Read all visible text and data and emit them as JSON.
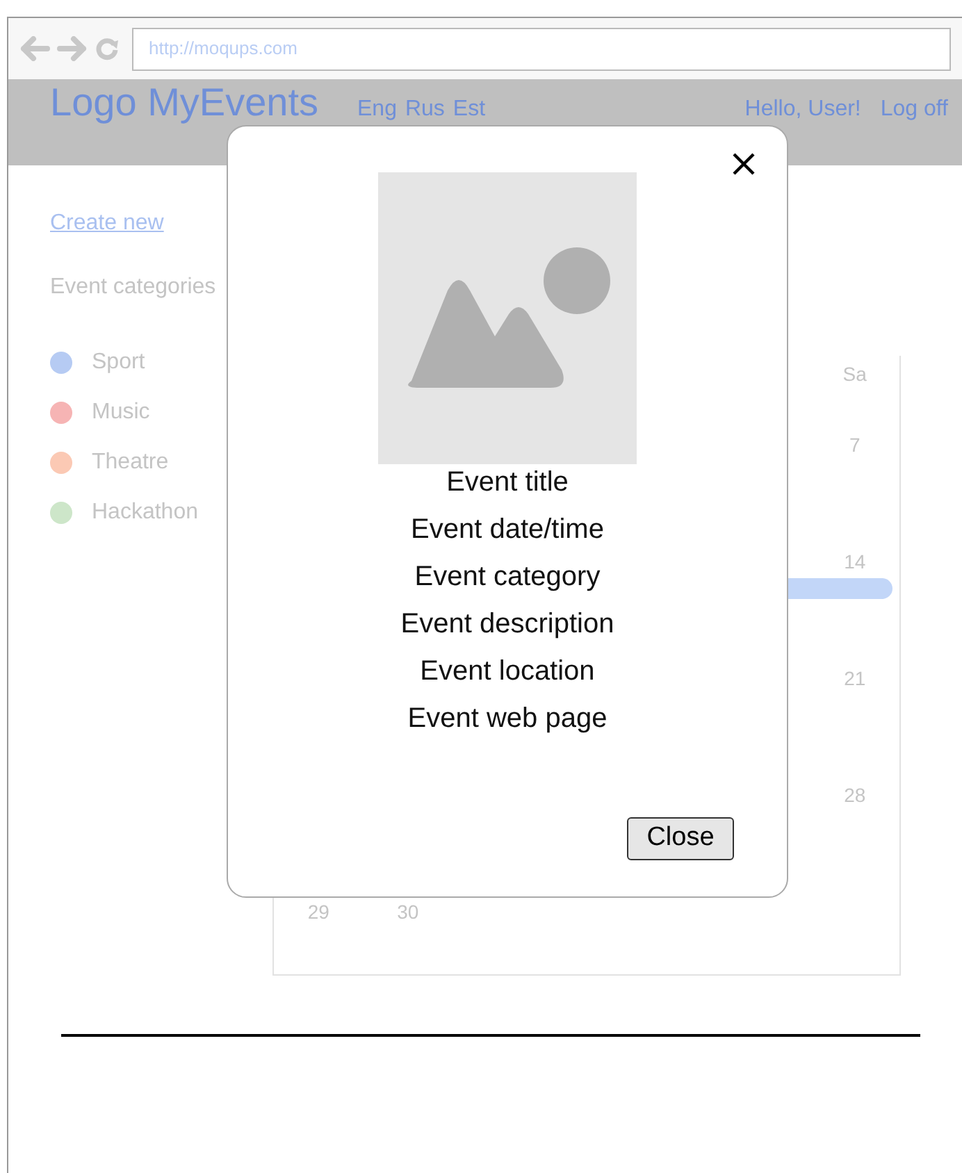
{
  "browser": {
    "url": "http://moqups.com"
  },
  "header": {
    "logo": "Logo MyEvents",
    "languages": [
      {
        "label": "Eng"
      },
      {
        "label": "Rus"
      },
      {
        "label": "Est"
      }
    ],
    "greeting": "Hello, User!",
    "logout": "Log off"
  },
  "sidebar": {
    "create_link": "Create new",
    "categories_title": "Event categories",
    "categories": [
      {
        "label": "Sport",
        "color": "#b6cbf3"
      },
      {
        "label": "Music",
        "color": "#f6b4b4"
      },
      {
        "label": "Theatre",
        "color": "#fbc9b4"
      },
      {
        "label": "Hackathon",
        "color": "#cde6c9"
      }
    ]
  },
  "calendar": {
    "day_headers": [
      "Sa"
    ],
    "weeks": [
      {
        "days": [
          "7"
        ]
      },
      {
        "days": [
          "14"
        ],
        "event": true
      },
      {
        "days": [
          "21"
        ]
      },
      {
        "days": [
          "28"
        ]
      },
      {
        "days": [
          "29",
          "30"
        ]
      }
    ]
  },
  "modal": {
    "fields": [
      "Event title",
      "Event date/time",
      "Event category",
      "Event description",
      "Event location",
      "Event web page"
    ],
    "close_button": "Close"
  }
}
